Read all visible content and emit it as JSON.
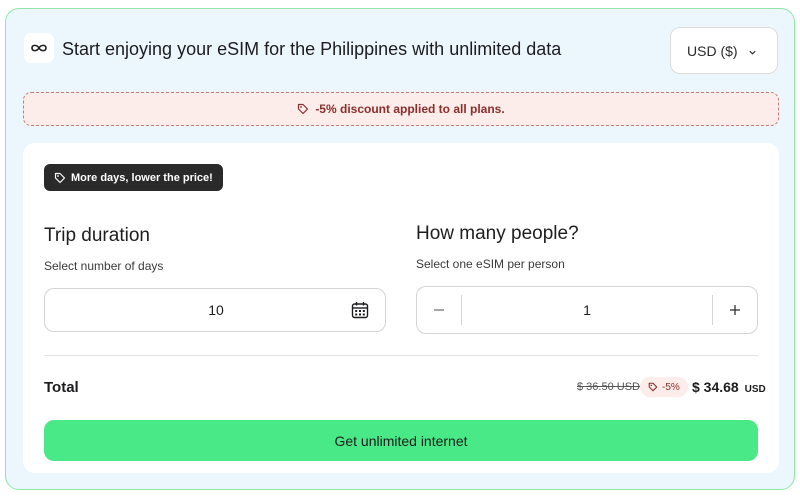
{
  "header": {
    "title": "Start enjoying your eSIM for the Philippines with unlimited data",
    "logo_icon": "infinity-icon",
    "currency": "USD ($)"
  },
  "discount_banner": {
    "text": "-5% discount applied to all plans.",
    "icon": "tag-icon"
  },
  "promo_pill": {
    "text": "More days, lower the price!",
    "icon": "tag-icon"
  },
  "trip": {
    "title": "Trip duration",
    "subtitle": "Select number of days",
    "value": "10",
    "icon": "calendar-icon"
  },
  "people": {
    "title": "How many people?",
    "subtitle": "Select one eSIM per person",
    "value": "1"
  },
  "total": {
    "label": "Total",
    "old_price": "$ 36.50 USD",
    "discount": "-5%",
    "new_price": "$ 34.68",
    "currency": "USD"
  },
  "cta": {
    "label": "Get unlimited internet"
  },
  "colors": {
    "accent_green": "#48e986",
    "frame_border": "#8fe6a8",
    "background": "#ecf7fd",
    "discount_red": "#8a2f2c"
  }
}
